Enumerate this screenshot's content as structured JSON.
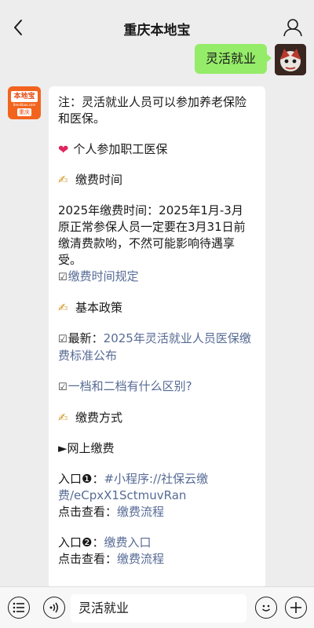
{
  "header": {
    "title": "重庆本地宝"
  },
  "user_message": {
    "text": "灵活就业"
  },
  "bot_avatar": {
    "logo_text": "本地宝",
    "logo_url": "Bendibao.com",
    "city": "重庆"
  },
  "reply": {
    "note": "注：灵活就业人员可以参加养老保险和医保。",
    "section_personal": "个人参加职工医保",
    "section_payment_time": "缴费时间",
    "payment_time_line1": "2025年缴费时间：2025年1月-3月",
    "payment_time_line2": "原正常参保人员一定要在3月31日前缴清费款哟，不然可能影响待遇享受。",
    "link_time_rules": "缴费时间规定",
    "section_policy": "基本政策",
    "latest_prefix": "最新：",
    "link_2025_standard": "2025年灵活就业人员医保缴费标准公布",
    "link_tiers": "一档和二档有什么区别?",
    "section_method": "缴费方式",
    "online_payment": "►网上缴费",
    "entry1_prefix": "入口❶：",
    "entry1_link": "#小程序://社保云缴费/eCpxX1SctmuvRan",
    "view_prefix": "点击查看：",
    "link_flow": "缴费流程",
    "entry2_prefix": "入口❷：",
    "entry2_link": "缴费入口",
    "view_prefix2": "点击查看：",
    "link_flow2": "缴费流程"
  },
  "input_bar": {
    "value": "灵活就业"
  },
  "colors": {
    "bubble_out": "#95ec69",
    "link": "#576b95",
    "background": "#ededed"
  }
}
